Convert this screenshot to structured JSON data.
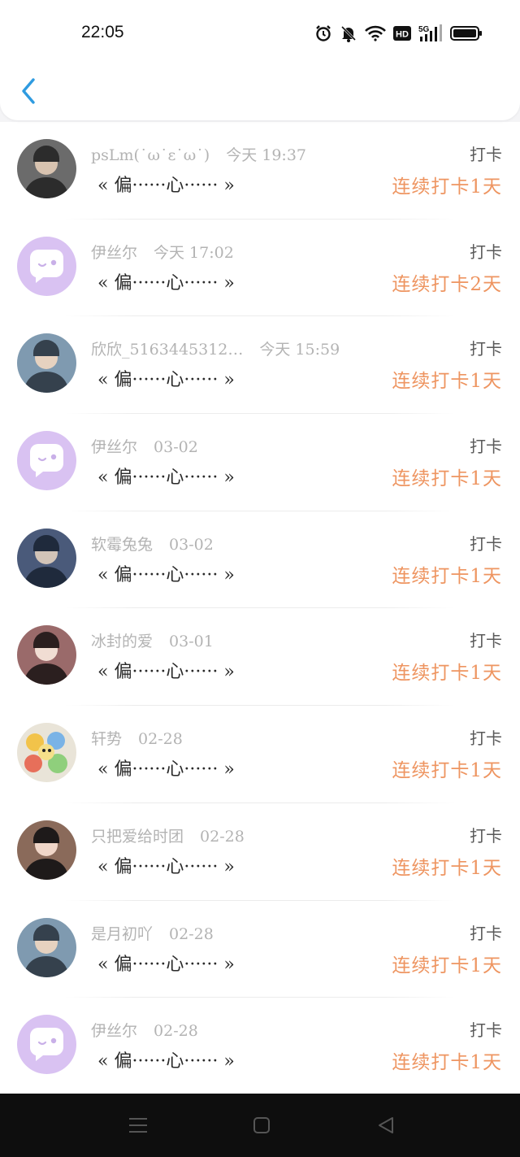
{
  "status_bar": {
    "time": "22:05",
    "icons": [
      "alarm-icon",
      "mute-bell-icon",
      "wifi-icon",
      "hd-icon",
      "5g-signal-icon",
      "battery-icon"
    ],
    "hd_label": "HD",
    "network_label": "5G"
  },
  "header": {
    "back_icon": "chevron-left-icon",
    "accent_color": "#2f9be0"
  },
  "records": [
    {
      "user": "psLm(˙ω˙ε˙ω˙)",
      "date": "今天 19:37",
      "quote": "« 偏······心······ »",
      "type": "打卡",
      "streak": "连续打卡1天",
      "avatar": "photo"
    },
    {
      "user": "伊丝尔",
      "date": "今天 17:02",
      "quote": "« 偏······心······ »",
      "type": "打卡",
      "streak": "连续打卡2天",
      "avatar": "default"
    },
    {
      "user": "欣欣_5163445312…",
      "date": "今天 15:59",
      "quote": "« 偏······心······ »",
      "type": "打卡",
      "streak": "连续打卡1天",
      "avatar": "photo"
    },
    {
      "user": "伊丝尔",
      "date": "03-02",
      "quote": "« 偏······心······ »",
      "type": "打卡",
      "streak": "连续打卡1天",
      "avatar": "default"
    },
    {
      "user": "软霉兔兔",
      "date": "03-02",
      "quote": "« 偏······心······ »",
      "type": "打卡",
      "streak": "连续打卡1天",
      "avatar": "photo"
    },
    {
      "user": "冰封的爱",
      "date": "03-01",
      "quote": "« 偏······心······ »",
      "type": "打卡",
      "streak": "连续打卡1天",
      "avatar": "photo"
    },
    {
      "user": "轩势",
      "date": "02-28",
      "quote": "« 偏······心······ »",
      "type": "打卡",
      "streak": "连续打卡1天",
      "avatar": "cartoon"
    },
    {
      "user": "只把爱给时团",
      "date": "02-28",
      "quote": "« 偏······心······ »",
      "type": "打卡",
      "streak": "连续打卡1天",
      "avatar": "photo"
    },
    {
      "user": "是月初吖",
      "date": "02-28",
      "quote": "« 偏······心······ »",
      "type": "打卡",
      "streak": "连续打卡1天",
      "avatar": "photo"
    },
    {
      "user": "伊丝尔",
      "date": "02-28",
      "quote": "« 偏······心······ »",
      "type": "打卡",
      "streak": "连续打卡1天",
      "avatar": "default"
    }
  ],
  "colors": {
    "streak": "#ee9561",
    "default_avatar": "#d9c2f2",
    "meta_text": "#b3b3b3"
  },
  "nav_bar": {
    "icons": [
      "menu-icon",
      "home-square-icon",
      "back-triangle-icon"
    ]
  }
}
